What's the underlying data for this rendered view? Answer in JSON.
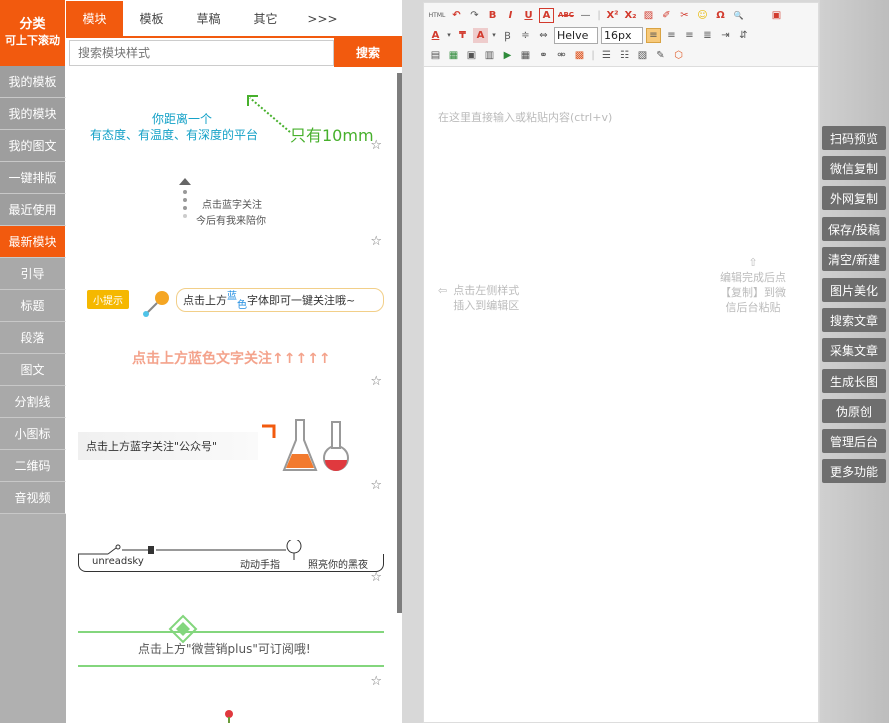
{
  "sidebar": {
    "header_line1": "分类",
    "header_line2": "可上下滚动",
    "items": [
      {
        "label": "我的模板"
      },
      {
        "label": "我的模块"
      },
      {
        "label": "我的图文"
      },
      {
        "label": "一键排版"
      },
      {
        "label": "最近使用"
      },
      {
        "label": "最新模块"
      },
      {
        "label": "引导"
      },
      {
        "label": "标题"
      },
      {
        "label": "段落"
      },
      {
        "label": "图文"
      },
      {
        "label": "分割线"
      },
      {
        "label": "小图标"
      },
      {
        "label": "二维码"
      },
      {
        "label": "音视频"
      }
    ]
  },
  "panel": {
    "tabs": [
      "模块",
      "模板",
      "草稿",
      "其它",
      ">>>"
    ],
    "search_placeholder": "搜索模块样式",
    "search_button": "搜索",
    "cards": {
      "c1_l1": "你距离一个",
      "c1_l2": "有态度、有温度、有深度的平台",
      "c1_l3": "只有10mm",
      "c2_l1": "点击蓝字关注",
      "c2_l2": "今后有我来陪你",
      "c3_badge": "小提示",
      "c3_box_a": "点击上方",
      "c3_box_blue1": "蓝",
      "c3_box_blue2": "色",
      "c3_box_b": "字体即可一键关注哦~",
      "c3_big": "点击上方蓝色文字关注↑↑↑↑↑",
      "c4_text": "点击上方蓝字关注\"公众号\"",
      "c5_a": "unreadsky",
      "c5_b": "动动手指",
      "c5_c": "照亮你的黑夜",
      "c6_text": "点击上方\"微营销plus\"可订阅哦!"
    }
  },
  "editor": {
    "font_family": "Helve",
    "font_size": "16px",
    "placeholder": "在这里直接输入或粘贴内容(ctrl+v)",
    "hint_left_1": "点击左侧样式",
    "hint_left_2": "插入到编辑区",
    "hint_right_1": "编辑完成后点",
    "hint_right_2": "【复制】到微",
    "hint_right_3": "信后台粘贴",
    "toolbar_row1": [
      "HTML",
      "↶",
      "↷",
      "B",
      "I",
      "U",
      "A",
      "ABC",
      "—",
      "|",
      "X²",
      "X₂",
      "▨",
      "✐",
      "✂",
      "☺",
      "Ω",
      "🔍",
      "▣"
    ]
  },
  "right_buttons": [
    "扫码预览",
    "微信复制",
    "外网复制",
    "保存/投稿",
    "清空/新建",
    "图片美化",
    "搜索文章",
    "采集文章",
    "生成长图",
    "伪原创",
    "管理后台",
    "更多功能"
  ]
}
